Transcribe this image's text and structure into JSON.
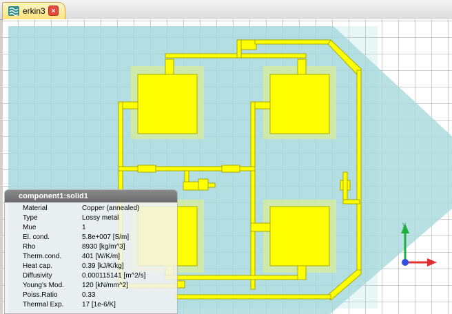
{
  "tab": {
    "title": "erkin3",
    "icon": "mesh-icon",
    "close": "×"
  },
  "scene": {
    "background": "#ffffff",
    "grid_color": "#9a9a9a",
    "substrate_color": "#a8dadd",
    "trace_color": "#ffff00",
    "trace_outline": "#a8a800"
  },
  "panel": {
    "title": "component1:solid1",
    "properties": [
      {
        "name": "Material",
        "value": "Copper (annealed)"
      },
      {
        "name": "Type",
        "value": "Lossy metal"
      },
      {
        "name": "Mue",
        "value": "1"
      },
      {
        "name": "El. cond.",
        "value": "5.8e+007 [S/m]"
      },
      {
        "name": "Rho",
        "value": "8930 [kg/m^3]"
      },
      {
        "name": "Therm.cond.",
        "value": "401 [W/K/m]"
      },
      {
        "name": "Heat cap.",
        "value": "0.39 [kJ/K/kg]"
      },
      {
        "name": "Diffusivity",
        "value": "0.000115141 [m^2/s]"
      },
      {
        "name": "Young's Mod.",
        "value": "120 [kN/mm^2]"
      },
      {
        "name": "Poiss.Ratio",
        "value": "0.33"
      },
      {
        "name": "Thermal Exp.",
        "value": "17 [1e-6/K]"
      }
    ]
  },
  "axes": {
    "y": "y",
    "z": "z",
    "x_color": "#e03030",
    "y_color": "#20b040",
    "z_color": "#3050e0"
  }
}
